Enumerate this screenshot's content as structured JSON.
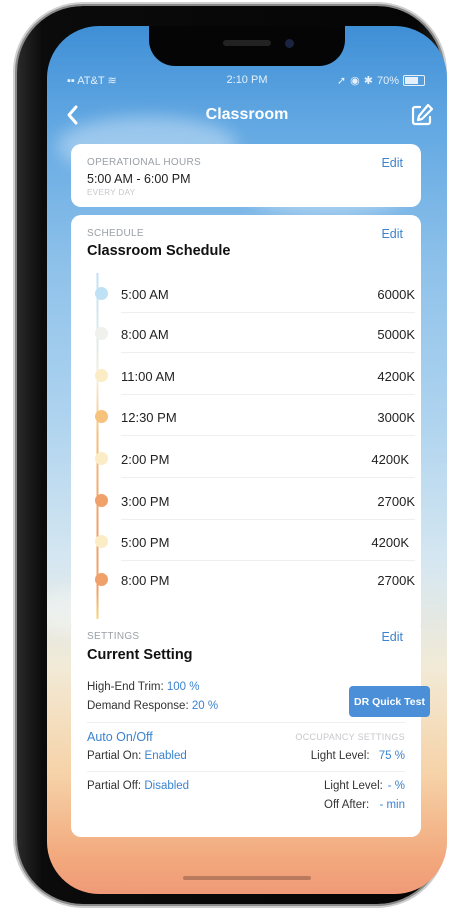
{
  "status_bar": {
    "carrier": "AT&T",
    "time": "2:10 PM",
    "battery": "70%"
  },
  "nav": {
    "title": "Classroom"
  },
  "operational_hours": {
    "label": "OPERATIONAL HOURS",
    "edit": "Edit",
    "hours": "5:00 AM - 6:00 PM",
    "days": "EVERY DAY"
  },
  "schedule": {
    "label": "SCHEDULE",
    "edit": "Edit",
    "title": "Classroom Schedule",
    "entries": [
      {
        "time": "5:00 AM",
        "kelvin": "6000K",
        "color": "#bfe1f5"
      },
      {
        "time": "8:00 AM",
        "kelvin": "5000K",
        "color": "#f0f0ec"
      },
      {
        "time": "11:00 AM",
        "kelvin": "4200K",
        "color": "#fbecc5"
      },
      {
        "time": "12:30 PM",
        "kelvin": "3000K",
        "color": "#f6c27c"
      },
      {
        "time": "2:00 PM",
        "kelvin": "4200K",
        "color": "#fbecc5"
      },
      {
        "time": "3:00 PM",
        "kelvin": "2700K",
        "color": "#f0a16a"
      },
      {
        "time": "5:00 PM",
        "kelvin": "4200K",
        "color": "#fbecc5"
      },
      {
        "time": "8:00 PM",
        "kelvin": "2700K",
        "color": "#f0a16a"
      }
    ]
  },
  "settings": {
    "label": "SETTINGS",
    "edit": "Edit",
    "title": "Current Setting",
    "high_end_trim_label": "High-End Trim:",
    "high_end_trim_value": "100 %",
    "demand_response_label": "Demand Response:",
    "demand_response_value": "20 %",
    "dr_button": "DR Quick Test",
    "auto_on_off": "Auto On/Off",
    "occupancy_settings": "OCCUPANCY SETTINGS",
    "partial_on_label": "Partial On:",
    "partial_on_value": "Enabled",
    "light_level_label": "Light Level:",
    "light_level_value": "75 %",
    "partial_off_label": "Partial Off:",
    "partial_off_value": "Disabled",
    "light_level2_label": "Light Level:",
    "light_level2_value": "- %",
    "off_after_label": "Off After:",
    "off_after_value": "- min"
  }
}
